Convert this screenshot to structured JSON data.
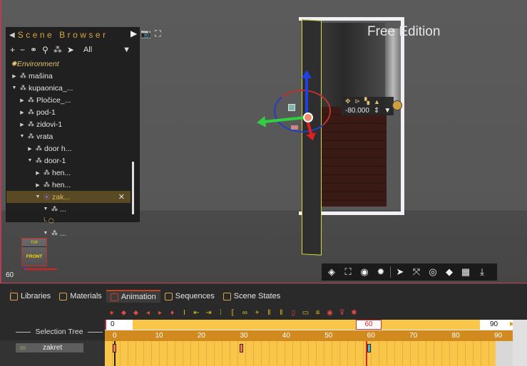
{
  "viewport": {
    "watermark": "Free Edition",
    "fps": "60",
    "view_cube": {
      "top": "TOP",
      "front": "FRONT"
    }
  },
  "scene_browser": {
    "title": "Scene Browser",
    "filter": "All",
    "tree": [
      {
        "label": "Environment",
        "indent": 0,
        "kind": "env"
      },
      {
        "label": "mašina",
        "indent": 0,
        "arrow": "▶"
      },
      {
        "label": "kupaonica_...",
        "indent": 0,
        "arrow": "▼"
      },
      {
        "label": "Pločice_...",
        "indent": 1,
        "arrow": "▶"
      },
      {
        "label": "pod-1",
        "indent": 1,
        "arrow": "▶"
      },
      {
        "label": "zidovi-1",
        "indent": 1,
        "arrow": "▶"
      },
      {
        "label": "vrata",
        "indent": 1,
        "arrow": "▼"
      },
      {
        "label": "door h...",
        "indent": 2,
        "arrow": "▶"
      },
      {
        "label": "door-1",
        "indent": 2,
        "arrow": "▼"
      },
      {
        "label": "hen...",
        "indent": 3,
        "arrow": "▶"
      },
      {
        "label": "hen...",
        "indent": 3,
        "arrow": "▶"
      },
      {
        "label": "zak...",
        "indent": 3,
        "arrow": "▼",
        "selected": true
      },
      {
        "label": "...",
        "indent": 4,
        "arrow": "▼"
      },
      {
        "label": "",
        "indent": 4,
        "kind": "leaf"
      },
      {
        "label": "...",
        "indent": 4,
        "arrow": "▼"
      }
    ]
  },
  "gizmo_panel": {
    "value": "-80.000"
  },
  "bottom_tabs": [
    {
      "label": "Libraries",
      "color": "#d9a64a"
    },
    {
      "label": "Materials",
      "color": "#d9a64a"
    },
    {
      "label": "Animation",
      "color": "#c94020",
      "active": true
    },
    {
      "label": "Sequences",
      "color": "#d9a64a"
    },
    {
      "label": "Scene States",
      "color": "#d9a64a"
    }
  ],
  "timeline": {
    "start": "0",
    "current": "60",
    "end": "90",
    "ruler": [
      "0",
      "10",
      "20",
      "30",
      "40",
      "50",
      "60",
      "70",
      "80",
      "90"
    ],
    "selection_tree_label": "Selection Tree",
    "track_name": "zakret",
    "keyframes": [
      0,
      30,
      60
    ]
  },
  "colors": {
    "accent": "#d8a640",
    "timeline_range": "#fac64a",
    "ruler": "#d08a20",
    "playhead": "#e0202a"
  }
}
